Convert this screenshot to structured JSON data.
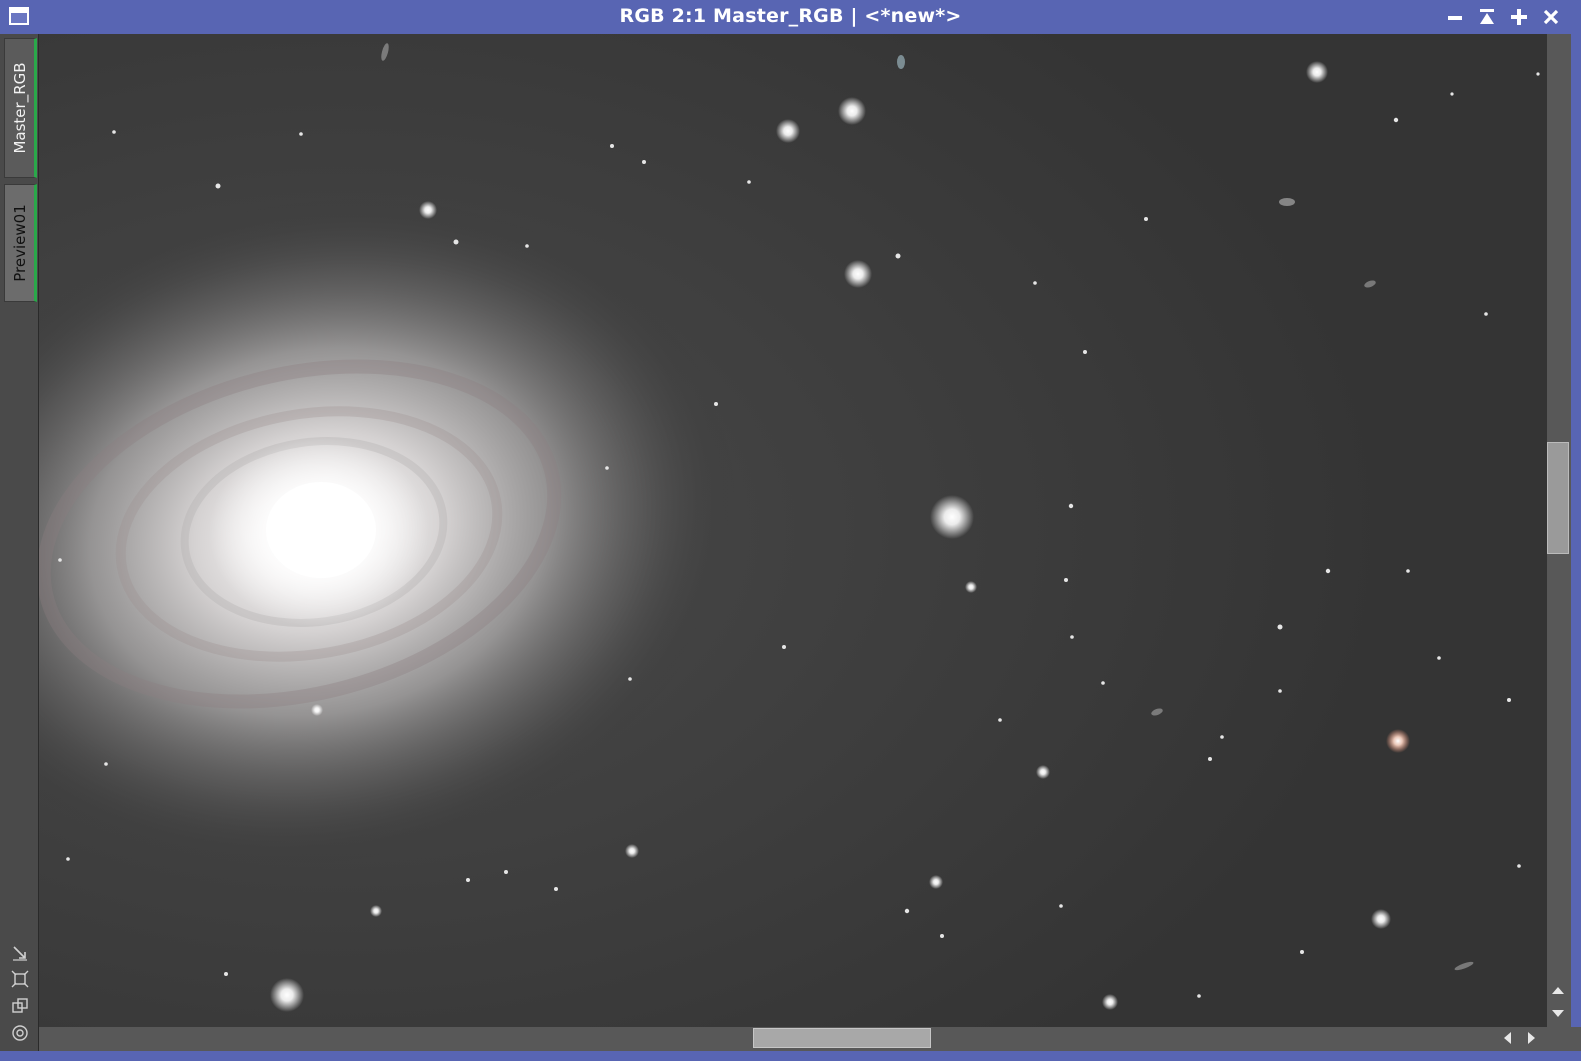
{
  "window": {
    "title": "RGB 2:1 Master_RGB | <*new*>"
  },
  "tabs": [
    {
      "label": "Master_RGB"
    },
    {
      "label": "Preview01"
    }
  ],
  "colors": {
    "titlebar": "#5865b3",
    "tab_accent": "#2aa84a",
    "image_background": "#363636"
  },
  "icons": {
    "window_menu": "window-menu-icon",
    "minimize": "minimize-icon",
    "shade": "shade-icon",
    "maximize": "maximize-icon",
    "close": "close-icon",
    "tools": [
      "zoom-to-fit-icon",
      "fit-view-icon",
      "clone-view-icon",
      "target-icon"
    ]
  }
}
